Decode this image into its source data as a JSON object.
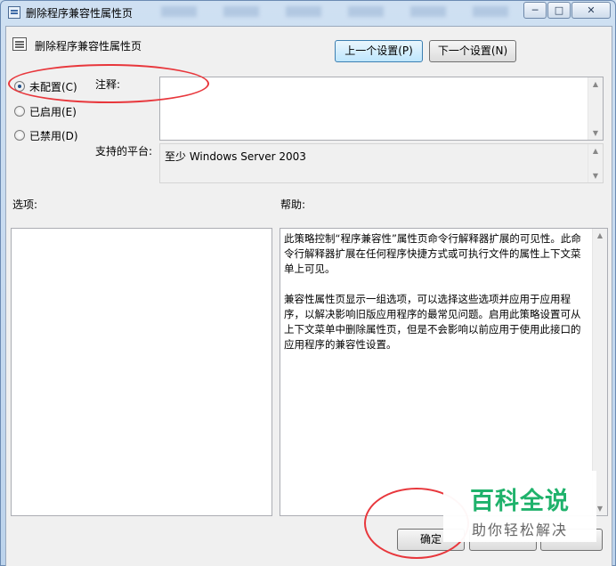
{
  "window": {
    "title": "删除程序兼容性属性页",
    "minimize_glyph": "─",
    "maximize_glyph": "□",
    "close_glyph": "✕"
  },
  "header": {
    "policy_title": "删除程序兼容性属性页",
    "prev_button": "上一个设置(P)",
    "next_button": "下一个设置(N)"
  },
  "state_options": [
    {
      "label": "未配置(C)",
      "checked": true
    },
    {
      "label": "已启用(E)",
      "checked": false
    },
    {
      "label": "已禁用(D)",
      "checked": false
    }
  ],
  "comment": {
    "label": "注释:",
    "value": ""
  },
  "platform": {
    "label": "支持的平台:",
    "value": "至少 Windows Server 2003"
  },
  "options_section": {
    "label": "选项:"
  },
  "help_section": {
    "label": "帮助:",
    "paragraph1": "此策略控制“程序兼容性”属性页命令行解释器扩展的可见性。此命令行解释器扩展在任何程序快捷方式或可执行文件的属性上下文菜单上可见。",
    "paragraph2": "兼容性属性页显示一组选项，可以选择这些选项并应用于应用程序，以解决影响旧版应用程序的最常见问题。启用此策略设置可从上下文菜单中删除属性页，但是不会影响以前应用于使用此接口的应用程序的兼容性设置。"
  },
  "footer": {
    "ok_button": "确定"
  },
  "watermark": {
    "logo": "百科全说",
    "slogan": "助你轻松解决"
  },
  "colors": {
    "annotation": "#e8373c",
    "watermark": "#1fb26b"
  }
}
